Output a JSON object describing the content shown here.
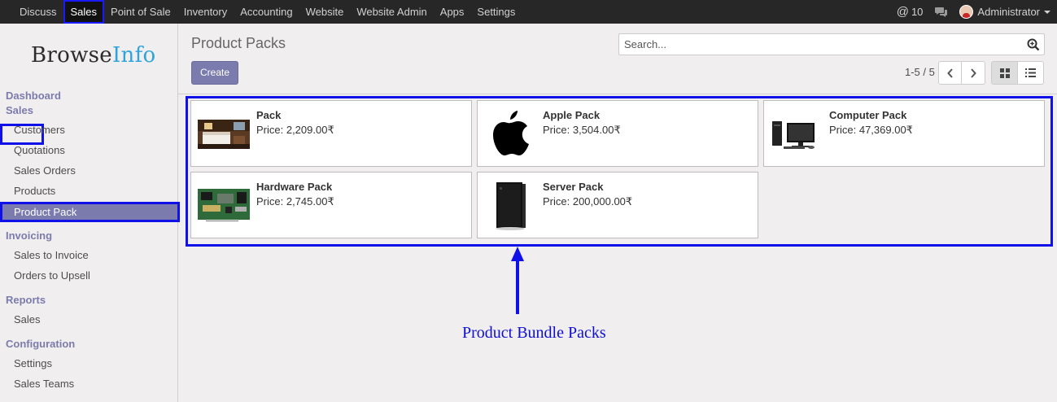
{
  "topnav": {
    "items": [
      "Discuss",
      "Sales",
      "Point of Sale",
      "Inventory",
      "Accounting",
      "Website",
      "Website Admin",
      "Apps",
      "Settings"
    ],
    "active_index": 1,
    "messages_count": "10",
    "user": "Administrator"
  },
  "sidebar": {
    "logo_part1": "Browse",
    "logo_part2": "Info",
    "dashboard": "Dashboard",
    "sales_section": "Sales",
    "sales_items": [
      "Customers",
      "Quotations",
      "Sales Orders",
      "Products"
    ],
    "active_item": "Product Pack",
    "invoicing_section": "Invoicing",
    "invoicing_items": [
      "Sales to Invoice",
      "Orders to Upsell"
    ],
    "reports_section": "Reports",
    "reports_items": [
      "Sales"
    ],
    "config_section": "Configuration",
    "config_items": [
      "Settings",
      "Sales Teams"
    ]
  },
  "control": {
    "title": "Product Packs",
    "search_placeholder": "Search...",
    "create_label": "Create",
    "pager": "1-5 / 5"
  },
  "packs": [
    {
      "name": "Pack",
      "price": "Price: 2,209.00₹",
      "icon": "hotel-room-image"
    },
    {
      "name": "Apple Pack",
      "price": "Price: 3,504.00₹",
      "icon": "apple-logo-icon"
    },
    {
      "name": "Computer Pack",
      "price": "Price: 47,369.00₹",
      "icon": "computer-image"
    },
    {
      "name": "Hardware Pack",
      "price": "Price: 2,745.00₹",
      "icon": "circuit-board-image"
    },
    {
      "name": "Server Pack",
      "price": "Price: 200,000.00₹",
      "icon": "server-tower-image"
    }
  ],
  "annotation": {
    "caption": "Product Bundle Packs",
    "color": "#1010e8"
  }
}
